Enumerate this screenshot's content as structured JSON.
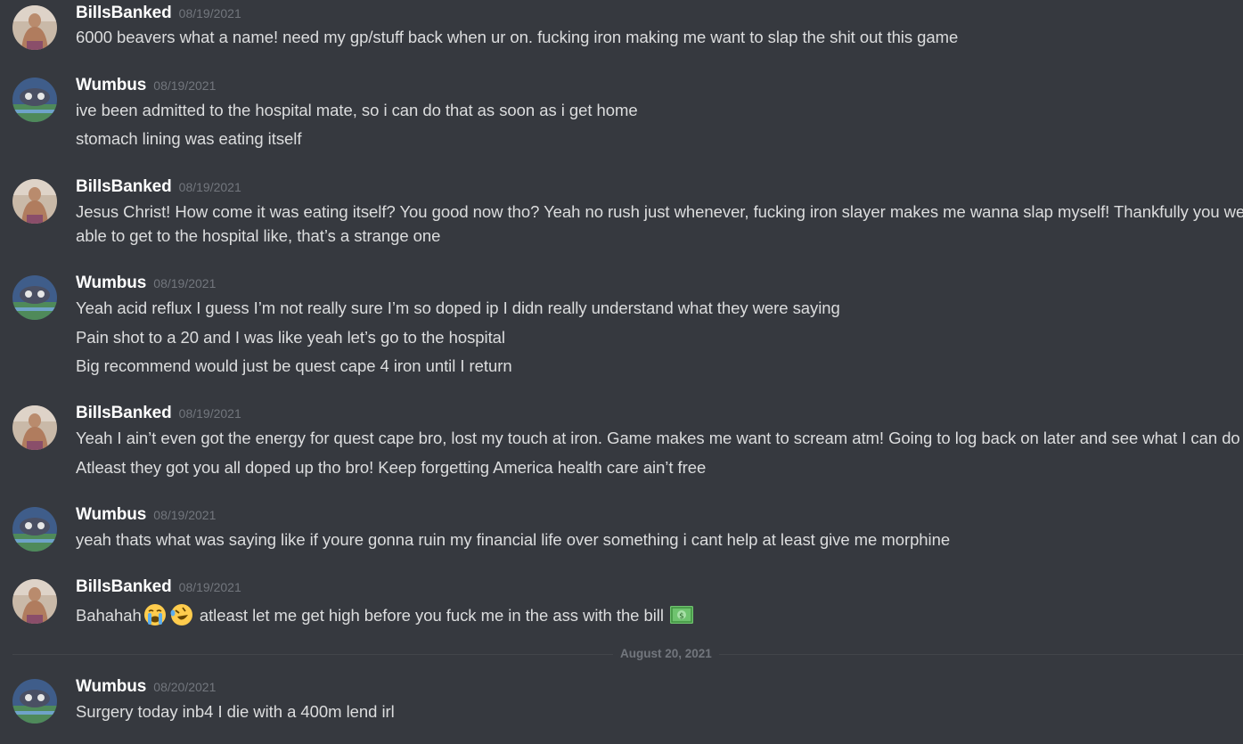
{
  "messages": [
    {
      "author": "BillsBanked",
      "timestamp": "08/19/2021",
      "lines": [
        "6000 beavers what a name! need my gp/stuff back when ur on. fucking iron making me want to slap the shit out this game"
      ]
    },
    {
      "author": "Wumbus",
      "timestamp": "08/19/2021",
      "lines": [
        "ive been admitted to the hospital mate, so i can do that as soon as i get home",
        "stomach lining was eating itself"
      ]
    },
    {
      "author": "BillsBanked",
      "timestamp": "08/19/2021",
      "lines": [
        "Jesus Christ! How come it was eating itself? You good now tho? Yeah no rush just whenever, fucking iron slayer makes me wanna slap myself! Thankfully you were able to get to the hospital like, that’s a strange one"
      ]
    },
    {
      "author": "Wumbus",
      "timestamp": "08/19/2021",
      "lines": [
        "Yeah acid reflux I guess I’m not really sure I’m so doped ip I didn really understand what they were saying",
        "Pain shot to a 20 and I was like yeah let’s go to the hospital",
        "Big recommend would just be quest cape 4 iron until I return"
      ]
    },
    {
      "author": "BillsBanked",
      "timestamp": "08/19/2021",
      "lines": [
        "Yeah I ain’t even got the energy for quest cape bro, lost my touch at iron. Game makes me want to scream atm! Going to log back on later and see what I can do",
        "Atleast they got you all doped up tho bro! Keep forgetting America health care ain’t free"
      ]
    },
    {
      "author": "Wumbus",
      "timestamp": "08/19/2021",
      "lines": [
        "yeah thats what  was saying like if youre gonna ruin my financial life over something i cant help at least give me morphine"
      ]
    },
    {
      "author": "BillsBanked",
      "timestamp": "08/19/2021",
      "line_parts": {
        "before": "Bahahah",
        "after": "atleast let me get high before you fuck me in the ass with the bill",
        "emojis": [
          "loudly-crying-face-icon",
          "rolling-on-floor-laughing-icon",
          "dollar-banknote-icon"
        ]
      }
    },
    {
      "author": "Wumbus",
      "timestamp": "08/20/2021",
      "lines": [
        "Surgery today inb4 I die with a 400m lend irl"
      ]
    }
  ],
  "date_divider": "August 20, 2021"
}
